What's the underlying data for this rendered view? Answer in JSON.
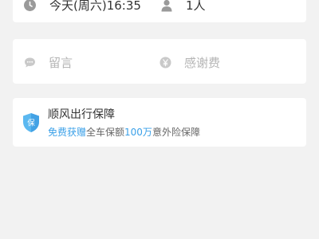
{
  "trip": {
    "time_text": "今天(周六)16:35",
    "passengers_text": "1人"
  },
  "extras": {
    "message_placeholder": "留言",
    "tip_placeholder": "感谢费"
  },
  "guarantee": {
    "title": "顺风出行保障",
    "shield_text": "保",
    "desc_free": "免费获赠",
    "desc_mid": "全车保额",
    "desc_amount": "100万",
    "desc_end": "意外险保障"
  },
  "colors": {
    "accent_blue": "#3aa0e8",
    "icon_gray": "#9a9a9a",
    "shield_light": "#5bb8f0",
    "shield_dark": "#2f8fdd"
  },
  "icons": {
    "time": "clock-icon",
    "passengers": "person-icon",
    "message": "speech-bubble-icon",
    "tip": "yen-icon",
    "guarantee": "shield-icon"
  }
}
